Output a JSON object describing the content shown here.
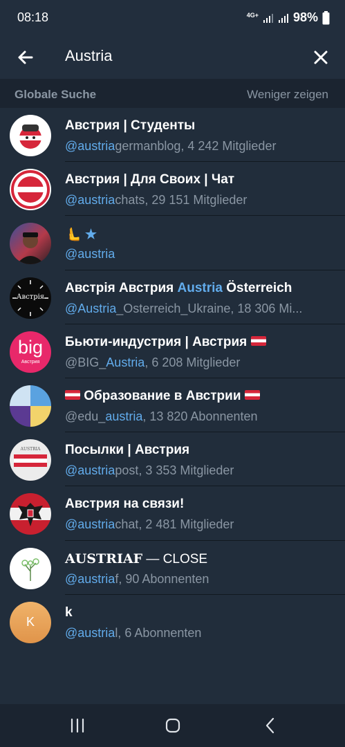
{
  "status": {
    "time": "08:18",
    "network": "4G+",
    "battery": "98%"
  },
  "search": {
    "query": "Austria"
  },
  "section": {
    "title": "Globale Suche",
    "action": "Weniger zeigen"
  },
  "results": [
    {
      "title": "Австрия | Студенты",
      "sub_hl": "@austria",
      "sub_rest": "germanblog, 4 242 Mitglieder",
      "avatar": "cartoon-ball-avatar"
    },
    {
      "title": "Австрия | Для Своих | Чат",
      "sub_hl": "@austria",
      "sub_rest": "chats, 29 151 Mitglieder",
      "avatar": "austrian-flag-ring-avatar"
    },
    {
      "title_emoji": "🫷",
      "title_star": "★",
      "sub_hl": "@austria",
      "sub_rest": "",
      "avatar": "person-photo-avatar"
    },
    {
      "title_pre": "Австрія Австрия ",
      "title_hl": "Austria",
      "title_post": " Österreich",
      "sub_hl": "@Austria",
      "sub_rest": "_Osterreich_Ukraine, 18 306 Mi...",
      "avatar": "dark-clock-logo-avatar",
      "avatar_text": "Австрія"
    },
    {
      "title": "Бьюти-индустрия | Австрия",
      "sub_pre": "@BIG_",
      "sub_hl": "Austria",
      "sub_rest": ", 6 208 Mitglieder",
      "avatar": "big-logo-avatar",
      "avatar_text": "big",
      "avatar_sub": "Австрия"
    },
    {
      "title": "Образование в Австрии",
      "sub_pre": "@edu_",
      "sub_hl": "austria",
      "sub_rest": ", 13 820 Abonnenten",
      "avatar": "color-quadrant-avatar"
    },
    {
      "title": "Посылки | Австрия",
      "sub_hl": "@austria",
      "sub_rest": "post, 3 353 Mitglieder",
      "avatar": "austria-flag-card-avatar",
      "avatar_text": "AUSTRIA"
    },
    {
      "title": "Австрия на связи!",
      "sub_hl": "@austria",
      "sub_rest": "chat, 2 481 Mitglieder",
      "avatar": "eagle-crest-avatar"
    },
    {
      "title_a": "AUSTRIAF",
      "title_b": " — CLOSE",
      "sub_hl": "@austria",
      "sub_rest": "f, 90 Abonnenten",
      "avatar": "plant-sketch-avatar"
    },
    {
      "title": "k",
      "sub_hl": "@austria",
      "sub_rest": "l, 6 Abonnenten",
      "avatar": "letter-k-avatar",
      "avatar_letter": "K"
    }
  ],
  "colors": {
    "background": "#212d3b",
    "header": "#222e3d",
    "section": "#1b2430",
    "link": "#62acec",
    "muted": "#8a96a3"
  }
}
